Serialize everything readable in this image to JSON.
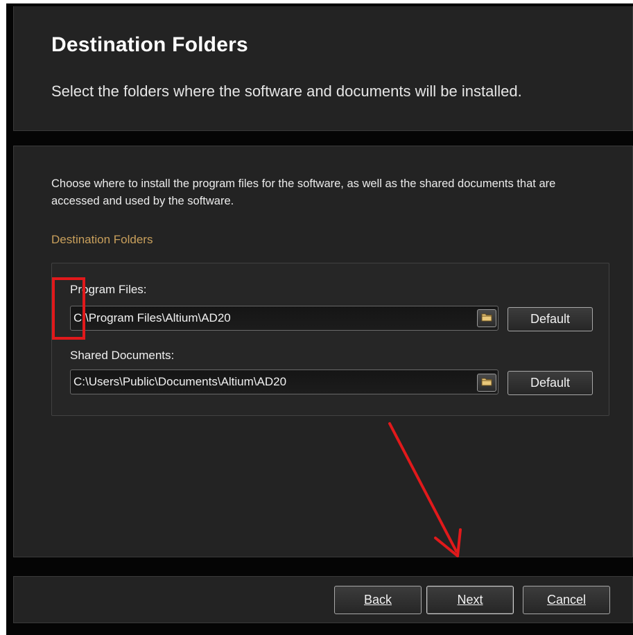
{
  "header": {
    "title": "Destination Folders",
    "subtitle": "Select the folders where the software and documents will be installed."
  },
  "main": {
    "description": "Choose where to install the program files for the software, as well as the shared documents that are accessed and used by the software.",
    "section_label": "Destination Folders",
    "program_files": {
      "label": "Program Files:",
      "value": "C:\\Program Files\\Altium\\AD20",
      "default_label": "Default"
    },
    "shared_documents": {
      "label": "Shared Documents:",
      "value": "C:\\Users\\Public\\Documents\\Altium\\AD20",
      "default_label": "Default"
    }
  },
  "footer": {
    "back_label": "Back",
    "next_label": "Next",
    "cancel_label": "Cancel"
  },
  "icons": {
    "browse": "folder-icon",
    "annotation_arrow": "arrow-icon"
  },
  "colors": {
    "background": "#232323",
    "section_label": "#c9a05c",
    "annotation": "#e1191b"
  }
}
